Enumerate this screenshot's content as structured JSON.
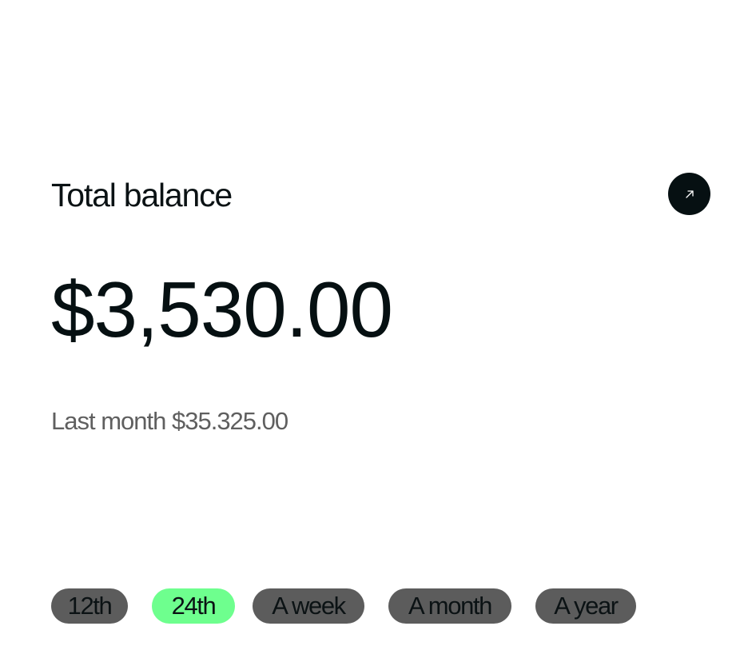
{
  "header": {
    "title": "Total balance",
    "action_icon": "arrow-up-right-icon"
  },
  "balance": {
    "amount": "$3,530.00",
    "last_month": "Last month $35.325.00"
  },
  "periods": {
    "options": [
      "12th",
      "24th",
      "A week",
      "A month",
      "A year"
    ],
    "selected": "24th"
  },
  "colors": {
    "text": "#0b1214",
    "muted_text": "#5f5f5f",
    "chip_bg": "#5c5c5c",
    "chip_active_bg": "#6eff8e",
    "button_bg": "#061012"
  }
}
